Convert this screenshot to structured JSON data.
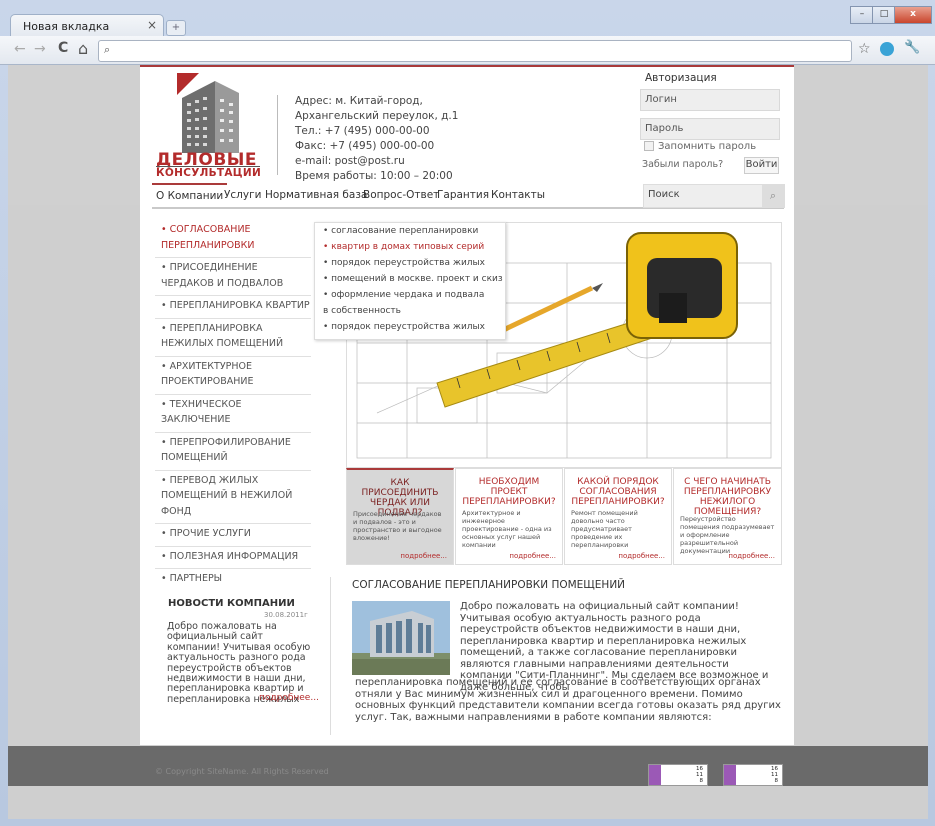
{
  "browser": {
    "tab_title": "Новая вкладка",
    "tab_close": "×",
    "new_tab": "+",
    "win_min": "–",
    "win_max": "□",
    "win_close": "x",
    "back": "←",
    "forward": "→",
    "reload": "C",
    "home": "⌂",
    "search_glyph": "⌕",
    "star": "☆",
    "wrench": "🔧"
  },
  "header": {
    "logo_line1": "ДЕЛОВЫЕ",
    "logo_line2": "КОНСУЛЬТАЦИИ",
    "contacts": [
      "Адрес: м. Китай-город,",
      "Архангельский переулок, д.1",
      "Тел.:  +7 (495) 000-00-00",
      "Факс: +7 (495) 000-00-00",
      "e-mail: post@post.ru",
      "Время работы: 10:00 – 20:00"
    ]
  },
  "auth": {
    "title": "Авторизация",
    "login_placeholder": "Логин",
    "password_placeholder": "Пароль",
    "remember": "Запомнить пароль",
    "forgot": "Забыли пароль?",
    "submit": "Войти"
  },
  "nav": {
    "items": [
      "О Компании",
      "Услуги",
      "Нормативная база",
      "Вопрос-Ответ",
      "Гарантия",
      "Контакты"
    ],
    "search_placeholder": "Поиск",
    "search_icon": "⌕"
  },
  "sidebar": {
    "items": [
      "• СОГЛАСОВАНИЕ ПЕРЕПЛАНИРОВКИ",
      "• ПРИСОЕДИНЕНИЕ ЧЕРДАКОВ И ПОДВАЛОВ",
      "• ПЕРЕПЛАНИРОВКА КВАРТИР",
      "• ПЕРЕПЛАНИРОВКА НЕЖИЛЫХ ПОМЕЩЕНИЙ",
      "• АРХИТЕКТУРНОЕ ПРОЕКТИРОВАНИЕ",
      "• ТЕХНИЧЕСКОЕ ЗАКЛЮЧЕНИЕ",
      "• ПЕРЕПРОФИЛИРОВАНИЕ ПОМЕЩЕНИЙ",
      "• ПЕРЕВОД ЖИЛЫХ ПОМЕЩЕНИЙ В НЕЖИЛОЙ ФОНД",
      "• ПРОЧИЕ УСЛУГИ",
      "• ПОЛЕЗНАЯ ИНФОРМАЦИЯ",
      "• ПАРТНЕРЫ"
    ]
  },
  "dropdown": {
    "items": [
      "• согласование перепланировки",
      "• квартир в домах типовых серий",
      "• порядок переустройства жилых",
      "• помещений в москве. проект и скиз",
      "• оформление чердака и подвала",
      "в собственность",
      "• порядок переустройства жилых"
    ]
  },
  "features": [
    {
      "title": "КАК ПРИСОЕДИНИТЬ ЧЕРДАК ИЛИ ПОДВАЛ?",
      "desc": "Присоединение чердаков и подвалов - это и пространство и выгодное вложение!",
      "more": "подробнее..."
    },
    {
      "title": "НЕОБХОДИМ ПРОЕКТ ПЕРЕПЛАНИРОВКИ?",
      "desc": "Архитектурное и инженерное проектирование - одна из основных услуг нашей компании",
      "more": "подробнее..."
    },
    {
      "title": "КАКОЙ ПОРЯДОК СОГЛАСОВАНИЯ ПЕРЕПЛАНИРОВКИ?",
      "desc": "Ремонт помещений довольно часто предусматривает проведение их перепланировки",
      "more": "подробнее..."
    },
    {
      "title": "С ЧЕГО НАЧИНАТЬ ПЕРЕПЛАНИРОВКУ НЕЖИЛОГО ПОМЕЩЕНИЯ?",
      "desc": "Переустройство помещения подразумевает и оформление разрешительной документации",
      "more": "подробнее..."
    }
  ],
  "news": {
    "title": "НОВОСТИ КОМПАНИИ",
    "date": "30.08.2011г",
    "text": "Добро пожаловать на официальный сайт компании! Учитывая особую актуальность разного рода переустройств объектов недвижимости в наши дни, перепланировка квартир и перепланировка нежилых",
    "more": "подробнее..."
  },
  "article": {
    "title": "СОГЛАСОВАНИЕ ПЕРЕПЛАНИРОВКИ ПОМЕЩЕНИЙ",
    "p1": "Добро пожаловать на официальный сайт компании! Учитывая особую актуальность разного рода переустройств объектов недвижимости в наши дни, перепланировка квартир и перепланировка нежилых помещений, а также согласование перепланировки являются главными направлениями деятельности компании \"Сити-Планнинг\". Мы сделаем все возможное и даже больше, чтобы",
    "p2": "перепланировка помещений и ее согласование в соответствующих органах отняли у Вас минимум жизненных сил и драгоценного времени. Помимо основных функций представители компании всегда готовы оказать ряд других услуг. Так, важными направлениями в работе компании являются:"
  },
  "footer": {
    "copyright": "© Copyright SiteName. All Rights Reserved",
    "counter_values": [
      "16",
      "11",
      "8"
    ]
  }
}
